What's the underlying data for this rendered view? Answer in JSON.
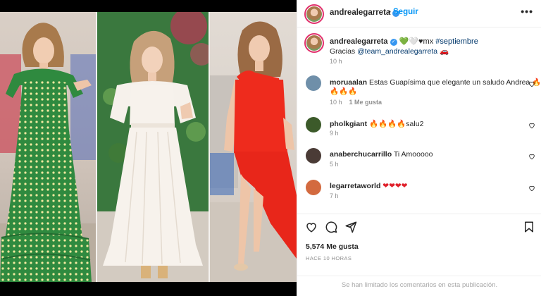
{
  "post": {
    "photos": [
      {
        "name": "green-polka-dot-dress-photo",
        "dress_color": "#2f8a3f"
      },
      {
        "name": "white-dress-photo",
        "dress_color": "#f4efe9"
      },
      {
        "name": "red-asymmetric-dress-photo",
        "dress_color": "#ee2b1d"
      }
    ]
  },
  "header": {
    "username": "andrealegarreta",
    "separator": "•",
    "follow_label": "Seguir",
    "more_label": "•••"
  },
  "caption": {
    "username": "andrealegarreta",
    "emojis": "💚🤍♥",
    "text_mid": "mx ",
    "hashtag": "#septiembre",
    "thanks": "Gracias ",
    "mention": "@team_andrealegarreta",
    "car_emoji": "🚗",
    "time": "10 h"
  },
  "comments": [
    {
      "username": "moruaalan",
      "text": "Estas Guapísima que elegante un saludo Andrea 🔥🔥🔥🔥",
      "line1": "Estas Guapísima que elegante un saludo Andrea 🔥",
      "line2": "🔥🔥🔥",
      "time": "10 h",
      "likes": "1 Me gusta",
      "avatar_color": "#6f8fa9"
    },
    {
      "username": "pholkgiant",
      "text": "🔥🔥🔥🔥salu2",
      "time": "9 h",
      "avatar_color": "#3c5a2a"
    },
    {
      "username": "anaberchucarrillo",
      "text": "Ti Amooooo",
      "time": "5 h",
      "avatar_color": "#4a3b36"
    },
    {
      "username": "legarretaworld",
      "text": "❤❤❤❤",
      "time": "7 h",
      "avatar_color": "#d36a3f"
    }
  ],
  "actions": {
    "likes": "5,574 Me gusta",
    "ago": "HACE 10 HORAS"
  },
  "footer": {
    "limited": "Se han limitado los comentarios en esta publicación."
  },
  "colors": {
    "accent": "#0095f6",
    "link": "#00376b",
    "muted": "#8e8e8e",
    "text": "#262626"
  },
  "icons": [
    "verified-badge-icon",
    "more-options-icon",
    "heart-icon",
    "comment-icon",
    "share-icon",
    "bookmark-icon"
  ]
}
